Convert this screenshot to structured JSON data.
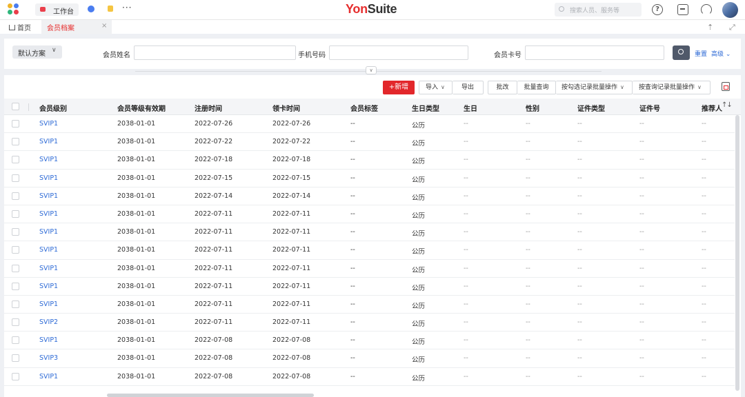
{
  "topbar": {
    "workbench_label": "工作台",
    "more_label": "···",
    "brand_yon": "Yon",
    "brand_suite": "Suite",
    "search_placeholder": "搜索人员、服务等",
    "help_label": "?"
  },
  "tabs": {
    "home_label": "首页",
    "active_label": "会员档案",
    "close_label": "×",
    "pin_label": "⇡",
    "expand_label": "⤢"
  },
  "filter": {
    "scheme_label": "默认方案",
    "scheme_caret": "∨",
    "name_label": "会员姓名",
    "name_value": "",
    "phone_label": "手机号码",
    "phone_value": "",
    "card_label": "会员卡号",
    "card_value": "",
    "clear_label": "重置",
    "advanced_label": "高级 ⌄",
    "collapse_label": "∨"
  },
  "toolbar": {
    "new_label": "+新增",
    "import_label": "导入",
    "export_label": "导出",
    "edit_label": "批改",
    "batch_query_label": "批量查询",
    "checked_batch_label": "按勾选记录批量操作",
    "query_batch_label": "按查询记录批量操作",
    "caret": "∨"
  },
  "table": {
    "columns": [
      "会员级别",
      "会员等级有效期",
      "注册时间",
      "领卡时间",
      "会员标签",
      "生日类型",
      "生日",
      "性别",
      "证件类型",
      "证件号",
      "推荐人"
    ],
    "sort_icon": "↑↓",
    "rows": [
      {
        "level": "SVIP1",
        "expiry": "2038-01-01",
        "registered": "2022-07-26",
        "card_date": "2022-07-26",
        "tag": "--",
        "birthday_type": "公历",
        "birthday": "--",
        "gender": "--",
        "id_type": "--",
        "id_no": "--",
        "referrer": "--"
      },
      {
        "level": "SVIP1",
        "expiry": "2038-01-01",
        "registered": "2022-07-22",
        "card_date": "2022-07-22",
        "tag": "--",
        "birthday_type": "公历",
        "birthday": "--",
        "gender": "--",
        "id_type": "--",
        "id_no": "--",
        "referrer": "--"
      },
      {
        "level": "SVIP1",
        "expiry": "2038-01-01",
        "registered": "2022-07-18",
        "card_date": "2022-07-18",
        "tag": "--",
        "birthday_type": "公历",
        "birthday": "--",
        "gender": "--",
        "id_type": "--",
        "id_no": "--",
        "referrer": "--"
      },
      {
        "level": "SVIP1",
        "expiry": "2038-01-01",
        "registered": "2022-07-15",
        "card_date": "2022-07-15",
        "tag": "--",
        "birthday_type": "公历",
        "birthday": "--",
        "gender": "--",
        "id_type": "--",
        "id_no": "--",
        "referrer": "--"
      },
      {
        "level": "SVIP1",
        "expiry": "2038-01-01",
        "registered": "2022-07-14",
        "card_date": "2022-07-14",
        "tag": "--",
        "birthday_type": "公历",
        "birthday": "--",
        "gender": "--",
        "id_type": "--",
        "id_no": "--",
        "referrer": "--"
      },
      {
        "level": "SVIP1",
        "expiry": "2038-01-01",
        "registered": "2022-07-11",
        "card_date": "2022-07-11",
        "tag": "--",
        "birthday_type": "公历",
        "birthday": "--",
        "gender": "--",
        "id_type": "--",
        "id_no": "--",
        "referrer": "--"
      },
      {
        "level": "SVIP1",
        "expiry": "2038-01-01",
        "registered": "2022-07-11",
        "card_date": "2022-07-11",
        "tag": "--",
        "birthday_type": "公历",
        "birthday": "--",
        "gender": "--",
        "id_type": "--",
        "id_no": "--",
        "referrer": "--"
      },
      {
        "level": "SVIP1",
        "expiry": "2038-01-01",
        "registered": "2022-07-11",
        "card_date": "2022-07-11",
        "tag": "--",
        "birthday_type": "公历",
        "birthday": "--",
        "gender": "--",
        "id_type": "--",
        "id_no": "--",
        "referrer": "--"
      },
      {
        "level": "SVIP1",
        "expiry": "2038-01-01",
        "registered": "2022-07-11",
        "card_date": "2022-07-11",
        "tag": "--",
        "birthday_type": "公历",
        "birthday": "--",
        "gender": "--",
        "id_type": "--",
        "id_no": "--",
        "referrer": "--"
      },
      {
        "level": "SVIP1",
        "expiry": "2038-01-01",
        "registered": "2022-07-11",
        "card_date": "2022-07-11",
        "tag": "--",
        "birthday_type": "公历",
        "birthday": "--",
        "gender": "--",
        "id_type": "--",
        "id_no": "--",
        "referrer": "--"
      },
      {
        "level": "SVIP1",
        "expiry": "2038-01-01",
        "registered": "2022-07-11",
        "card_date": "2022-07-11",
        "tag": "--",
        "birthday_type": "公历",
        "birthday": "--",
        "gender": "--",
        "id_type": "--",
        "id_no": "--",
        "referrer": "--"
      },
      {
        "level": "SVIP2",
        "expiry": "2038-01-01",
        "registered": "2022-07-11",
        "card_date": "2022-07-11",
        "tag": "--",
        "birthday_type": "公历",
        "birthday": "--",
        "gender": "--",
        "id_type": "--",
        "id_no": "--",
        "referrer": "--"
      },
      {
        "level": "SVIP1",
        "expiry": "2038-01-01",
        "registered": "2022-07-08",
        "card_date": "2022-07-08",
        "tag": "--",
        "birthday_type": "公历",
        "birthday": "--",
        "gender": "--",
        "id_type": "--",
        "id_no": "--",
        "referrer": "--"
      },
      {
        "level": "SVIP3",
        "expiry": "2038-01-01",
        "registered": "2022-07-08",
        "card_date": "2022-07-08",
        "tag": "--",
        "birthday_type": "公历",
        "birthday": "--",
        "gender": "--",
        "id_type": "--",
        "id_no": "--",
        "referrer": "--"
      },
      {
        "level": "SVIP1",
        "expiry": "2038-01-01",
        "registered": "2022-07-08",
        "card_date": "2022-07-08",
        "tag": "--",
        "birthday_type": "公历",
        "birthday": "--",
        "gender": "--",
        "id_type": "--",
        "id_no": "--",
        "referrer": "--"
      }
    ]
  },
  "colors": {
    "brand_red": "#e62e2e",
    "link_blue": "#2d6ad6",
    "primary_button": "#e2272b",
    "search_button": "#50596a"
  },
  "icons": [
    "app-logo-icon",
    "workbench-icon",
    "search-icon",
    "help-icon",
    "message-icon",
    "support-icon",
    "home-icon",
    "close-icon",
    "pin-icon",
    "expand-icon",
    "chevron-down-icon",
    "column-setting-icon",
    "sort-icon"
  ]
}
